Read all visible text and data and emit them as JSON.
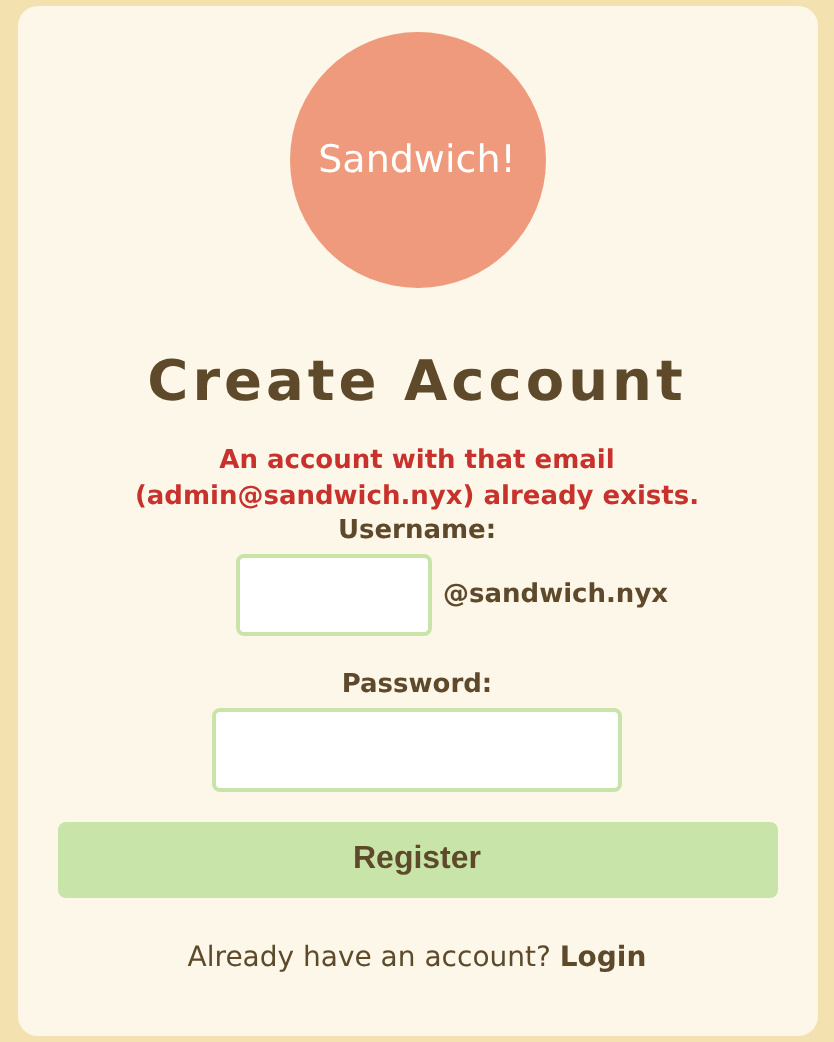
{
  "logo": {
    "text": "Sandwich!"
  },
  "title": "Create Account",
  "error": "An account with that email (admin@sandwich.nyx) already exists.",
  "username": {
    "label": "Username:",
    "suffix": "@sandwich.nyx"
  },
  "password": {
    "label": "Password:"
  },
  "register_button": "Register",
  "footer": {
    "text": "Already have an account?",
    "link": "Login"
  }
}
